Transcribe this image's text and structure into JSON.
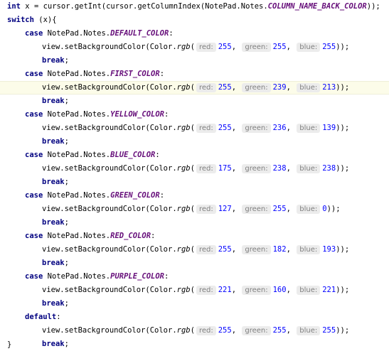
{
  "code": {
    "decl": {
      "type": "int",
      "var": "x",
      "eq": " = ",
      "call": "cursor.getInt(cursor.getColumnIndex(NotePad.Notes.",
      "const": "COLUMN_NAME_BACK_COLOR",
      "end": "));"
    },
    "switch": {
      "kw": "switch",
      "rest": " (x){"
    },
    "cases": [
      {
        "kw": "case",
        "prefix": "NotePad.Notes.",
        "const": "DEFAULT_COLOR",
        "colon": ":",
        "red": "255",
        "green": "255",
        "blue": "255"
      },
      {
        "kw": "case",
        "prefix": "NotePad.Notes.",
        "const": "FIRST_COLOR",
        "colon": ":",
        "red": "255",
        "green": "239",
        "blue": "213"
      },
      {
        "kw": "case",
        "prefix": "NotePad.Notes.",
        "const": "YELLOW_COLOR",
        "colon": ":",
        "red": "255",
        "green": "236",
        "blue": "139"
      },
      {
        "kw": "case",
        "prefix": "NotePad.Notes.",
        "const": "BLUE_COLOR",
        "colon": ":",
        "red": "175",
        "green": "238",
        "blue": "238"
      },
      {
        "kw": "case",
        "prefix": "NotePad.Notes.",
        "const": "GREEN_COLOR",
        "colon": ":",
        "red": "127",
        "green": "255",
        "blue": "0"
      },
      {
        "kw": "case",
        "prefix": "NotePad.Notes.",
        "const": "RED_COLOR",
        "colon": ":",
        "red": "255",
        "green": "182",
        "blue": "193"
      },
      {
        "kw": "case",
        "prefix": "NotePad.Notes.",
        "const": "PURPLE_COLOR",
        "colon": ":",
        "red": "221",
        "green": "160",
        "blue": "221"
      }
    ],
    "default": {
      "kw": "default",
      "colon": ":",
      "red": "255",
      "green": "255",
      "blue": "255"
    },
    "stmt": {
      "pre": "view.setBackgroundColor(Color.",
      "meth": "rgb",
      "open": "(",
      "sep": ", ",
      "end": "));"
    },
    "hints": {
      "red": "red:",
      "green": "green:",
      "blue": "blue:"
    },
    "break_kw": "break",
    "semicolon": ";",
    "close_brace": "}"
  },
  "colors": {
    "keyword": "#000080",
    "constant": "#660e7a",
    "number": "#0000ff",
    "hint_bg": "#ececec",
    "hint_fg": "#808080",
    "current_line": "#fcfce9"
  }
}
